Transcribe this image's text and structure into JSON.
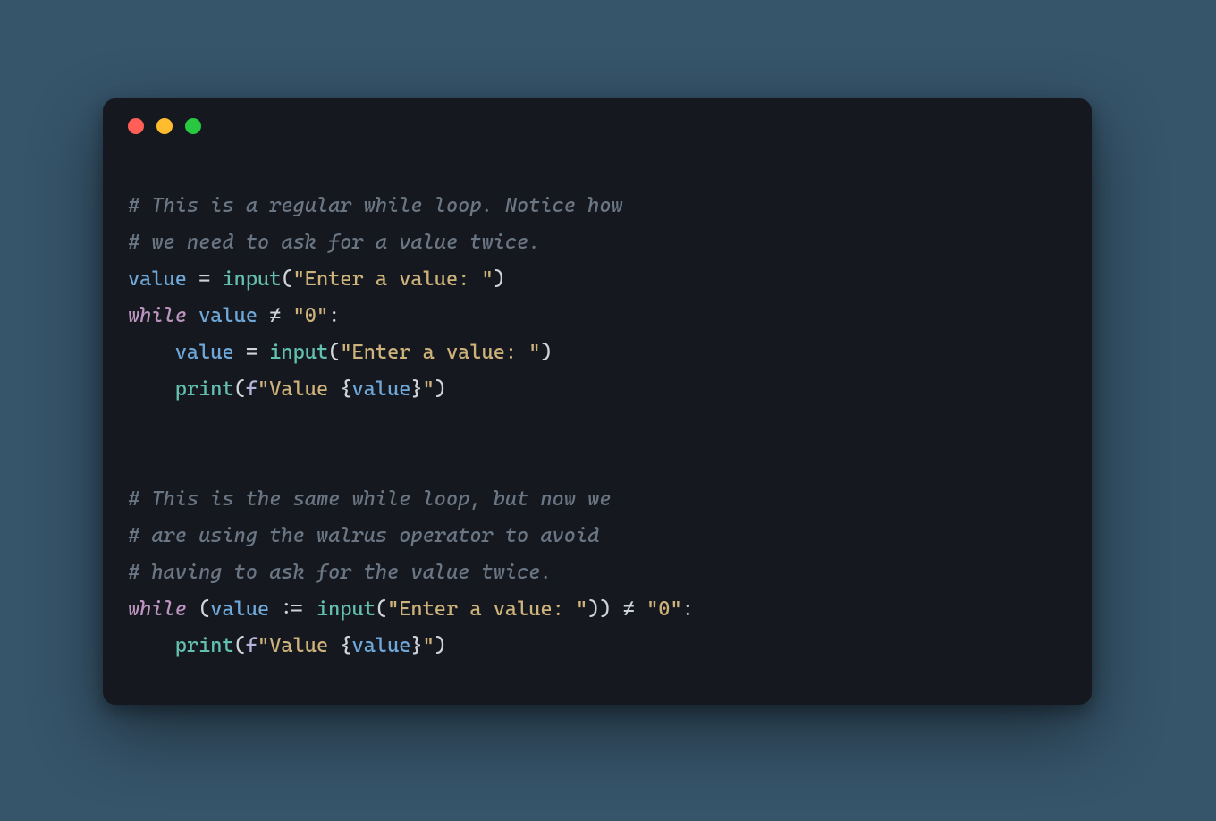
{
  "lines": {
    "c1": "# This is a regular while loop. Notice how",
    "c2": "# we need to ask for a value twice.",
    "l3_var": "value",
    "l3_eq": " = ",
    "l3_fn": "input",
    "l3_p1": "(",
    "l3_str": "\"Enter a value: \"",
    "l3_p2": ")",
    "l4_kw": "while",
    "l4_sp": " ",
    "l4_var": "value",
    "l4_op": " ≠ ",
    "l4_str": "\"0\"",
    "l4_colon": ":",
    "l5_indent": "    ",
    "l5_var": "value",
    "l5_eq": " = ",
    "l5_fn": "input",
    "l5_p1": "(",
    "l5_str": "\"Enter a value: \"",
    "l5_p2": ")",
    "l6_indent": "    ",
    "l6_fn": "print",
    "l6_p1": "(",
    "l6_fp": "f",
    "l6_s1": "\"Value ",
    "l6_b1": "{",
    "l6_var": "value",
    "l6_b2": "}",
    "l6_s2": "\"",
    "l6_p2": ")",
    "blank": "",
    "c3": "# This is the same while loop, but now we",
    "c4": "# are using the walrus operator to avoid",
    "c5": "# having to ask for the value twice.",
    "l11_kw": "while",
    "l11_sp": " ",
    "l11_p1": "(",
    "l11_var": "value",
    "l11_walrus": " := ",
    "l11_fn": "input",
    "l11_p2": "(",
    "l11_str": "\"Enter a value: \"",
    "l11_p3": ")) ",
    "l11_neq": "≠ ",
    "l11_str2": "\"0\"",
    "l11_colon": ":",
    "l12_indent": "    ",
    "l12_fn": "print",
    "l12_p1": "(",
    "l12_fp": "f",
    "l12_s1": "\"Value ",
    "l12_b1": "{",
    "l12_var": "value",
    "l12_b2": "}",
    "l12_s2": "\"",
    "l12_p2": ")"
  }
}
